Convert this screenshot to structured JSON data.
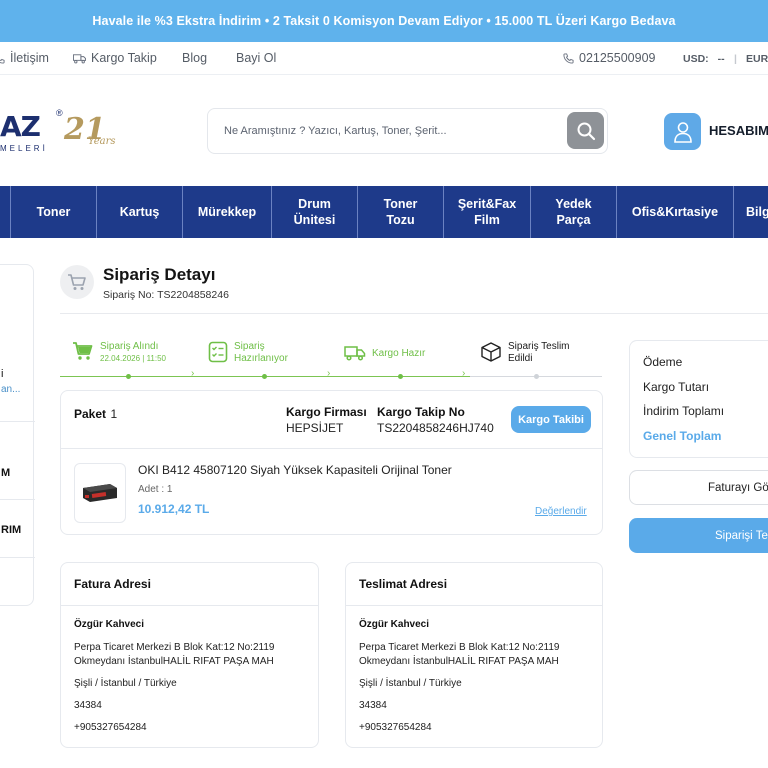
{
  "topbar": {
    "text": "Havale ile %3 Ekstra İndirim • 2 Taksit 0 Komisyon Devam Ediyor • 15.000 TL Üzeri Kargo Bedava"
  },
  "subnav": {
    "links": [
      "İletişim",
      "Kargo Takip",
      "Blog",
      "Bayi Ol"
    ],
    "phone": "02125500909",
    "usd_label": "USD:",
    "usd_value": "--",
    "divider": "|",
    "eur_label": "EUR:"
  },
  "logo": {
    "letters": "AZ",
    "reg": "®",
    "number": "21",
    "years": "Years",
    "sub": "MELERİ"
  },
  "search": {
    "placeholder": "Ne Aramıştınız ? Yazıcı, Kartuş, Toner, Şerit..."
  },
  "account": {
    "label": "HESABIM"
  },
  "mainnav": {
    "items": [
      {
        "line1": "Toner",
        "line2": ""
      },
      {
        "line1": "Kartuş",
        "line2": ""
      },
      {
        "line1": "Mürekkep",
        "line2": ""
      },
      {
        "line1": "Drum",
        "line2": "Ünitesi"
      },
      {
        "line1": "Toner",
        "line2": "Tozu"
      },
      {
        "line1": "Şerit&Fax",
        "line2": "Film"
      },
      {
        "line1": "Yedek",
        "line2": "Parça"
      },
      {
        "line1": "Ofis&Kırtasiye",
        "line2": ""
      },
      {
        "line1": "Bilg",
        "line2": ""
      }
    ]
  },
  "leftcard": {
    "i": "i",
    "link": "an...",
    "m": "M",
    "rim": "RIM"
  },
  "order": {
    "title": "Sipariş Detayı",
    "number_label": "Sipariş No:",
    "number": "TS2204858246"
  },
  "steps": [
    {
      "line1": "Sipariş Alındı",
      "line2": "",
      "sub": "22.04.2026 | 11:50",
      "done": true
    },
    {
      "line1": "Sipariş",
      "line2": "Hazırlanıyor",
      "sub": "",
      "done": true
    },
    {
      "line1": "Kargo Hazır",
      "line2": "",
      "sub": "",
      "done": true
    },
    {
      "line1": "Sipariş Teslim",
      "line2": "Edildi",
      "sub": "",
      "done": false
    }
  ],
  "package": {
    "label": "Paket",
    "index": "1",
    "carrier_label": "Kargo Firması",
    "carrier": "HEPSİJET",
    "tracking_label": "Kargo Takip No",
    "tracking": "TS2204858246HJ740",
    "track_button": "Kargo Takibi",
    "product": {
      "name": "OKI B412 45807120 Siyah Yüksek Kapasiteli Orijinal Toner",
      "qty": "Adet : 1",
      "price": "10.912,42 TL",
      "review_link": "Değerlendir"
    }
  },
  "billing": {
    "title": "Fatura Adresi",
    "name": "Özgür Kahveci",
    "address": "Perpa Ticaret Merkezi B Blok Kat:12 No:2119 Okmeydanı İstanbulHALİL RIFAT PAŞA MAH",
    "city": "Şişli / İstanbul / Türkiye",
    "zip": "34384",
    "phone": "+905327654284"
  },
  "shipping": {
    "title": "Teslimat Adresi",
    "name": "Özgür Kahveci",
    "address": "Perpa Ticaret Merkezi B Blok Kat:12 No:2119 Okmeydanı İstanbulHALİL RIFAT PAŞA MAH",
    "city": "Şişli / İstanbul / Türkiye",
    "zip": "34384",
    "phone": "+905327654284"
  },
  "summary": {
    "payment": "Ödeme",
    "shipping_cost": "Kargo Tutarı",
    "discount": "İndirim Toplamı",
    "total": "Genel Toplam"
  },
  "actions": {
    "invoice": "Faturayı Gö",
    "receive": "Siparişi Te"
  },
  "colors": {
    "accent": "#5aaae9",
    "nav": "#1e3a8a",
    "topbar": "#5fb2ec",
    "success": "#6fbf47"
  }
}
